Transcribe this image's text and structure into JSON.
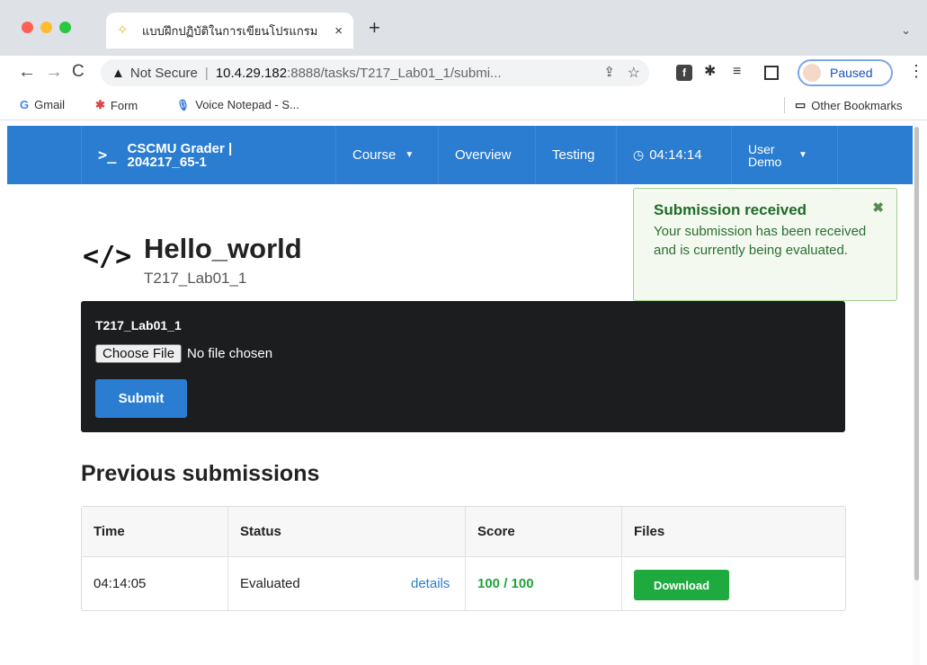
{
  "browser": {
    "tab_title": "แบบฝึกปฏิบัติในการเขียนโปรแกรม",
    "tab_close": "×",
    "new_tab": "+",
    "not_secure": "Not Secure",
    "url_host": "10.4.29.182",
    "url_path": ":8888/tasks/T217_Lab01_1/submi...",
    "profile_status": "Paused",
    "bookmarks": [
      {
        "label": "Gmail",
        "icon": "G"
      },
      {
        "label": "Form",
        "icon": "✱"
      },
      {
        "label": "Voice Notepad - S...",
        "icon": "🎙"
      }
    ],
    "other_bookmarks": "Other Bookmarks"
  },
  "navbar": {
    "brand_icon": ">_",
    "brand_line1": "CSCMU Grader |",
    "brand_line2": "204217_65-1",
    "course": "Course",
    "overview": "Overview",
    "testing": "Testing",
    "timer": "04:14:14",
    "user_line1": "User",
    "user_line2": "Demo"
  },
  "toast": {
    "title": "Submission received",
    "body": "Your submission has been received and is currently being evaluated.",
    "close": "✖"
  },
  "task": {
    "icon": "</>",
    "title": "Hello_world",
    "subtitle": "T217_Lab01_1"
  },
  "submit_panel": {
    "label": "T217_Lab01_1",
    "choose_file": "Choose File",
    "no_file": "No file chosen",
    "submit": "Submit"
  },
  "submissions": {
    "title": "Previous submissions",
    "headers": [
      "Time",
      "Status",
      "Score",
      "Files"
    ],
    "rows": [
      {
        "time": "04:14:05",
        "status": "Evaluated",
        "details": "details",
        "score": "100 / 100",
        "files": "Download"
      }
    ]
  },
  "colors": {
    "navbar": "#2a7dd0",
    "toast_bg": "#f3f9ef",
    "panel_bg": "#1c1d1f",
    "score": "#22a33a",
    "download": "#1faa3f"
  }
}
